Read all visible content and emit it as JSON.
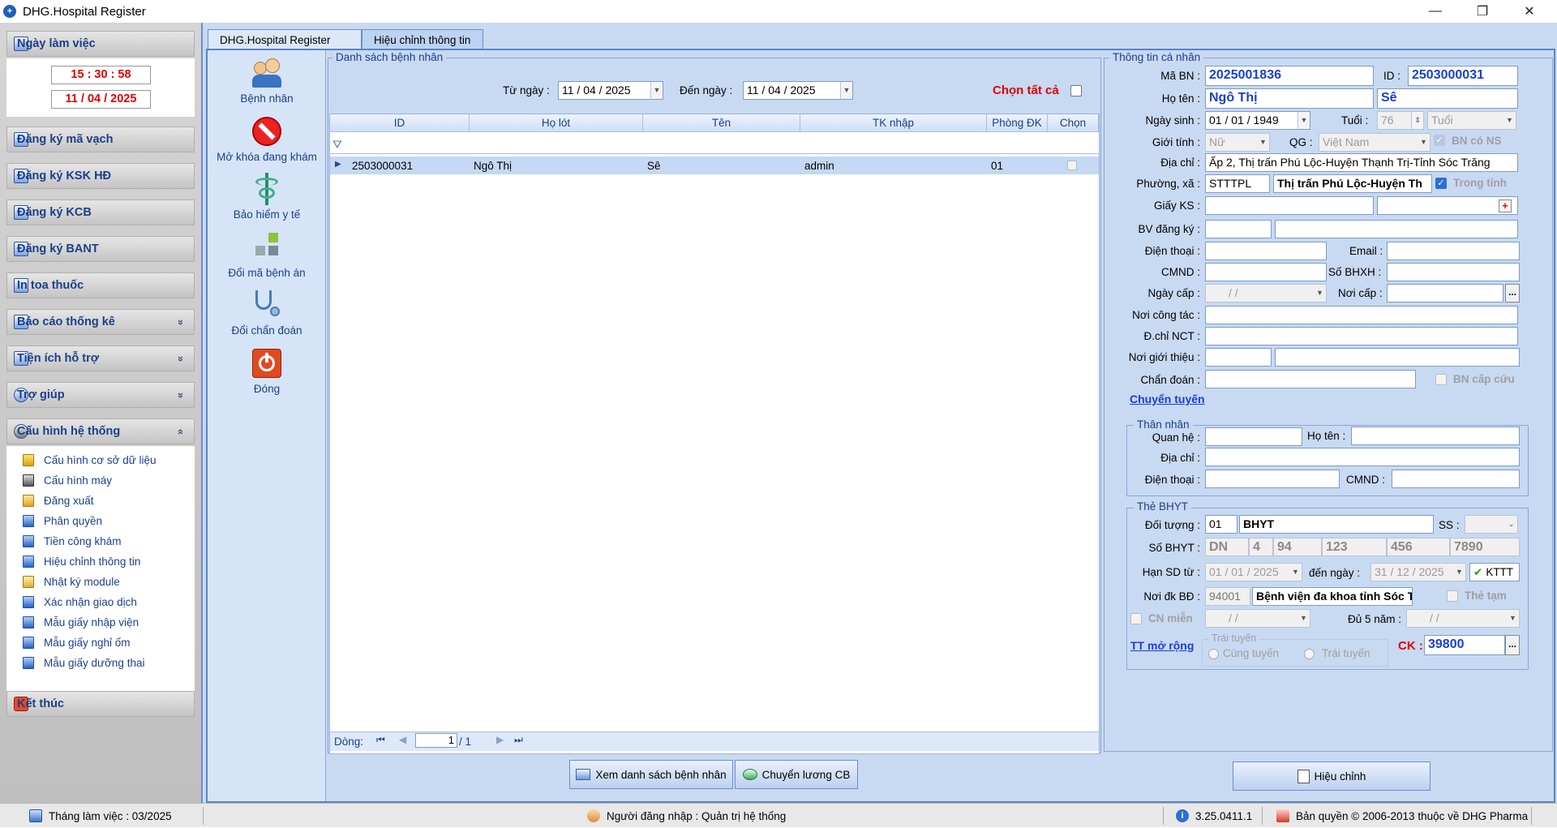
{
  "window": {
    "title": "DHG.Hospital Register",
    "icon": "hospital-cross-icon",
    "minimize": "—",
    "maximize": "❐",
    "close": "✕"
  },
  "sidebar": {
    "workday": {
      "label": "Ngày làm việc",
      "time": "15 : 30 : 58",
      "date": "11 / 04 / 2025"
    },
    "sections": [
      {
        "label": "Đăng ký mã vạch"
      },
      {
        "label": "Đăng ký KSK HĐ"
      },
      {
        "label": "Đăng ký KCB"
      },
      {
        "label": "Đăng ký BANT"
      },
      {
        "label": "In toa thuốc"
      },
      {
        "label": "Báo cáo thống kê",
        "chevron": "«"
      },
      {
        "label": "Tiện ích hỗ trợ",
        "chevron": "«"
      },
      {
        "label": "Trợ giúp",
        "chevron": "«"
      }
    ],
    "config": {
      "label": "Cấu hình hệ thống",
      "chevron": "»",
      "items": [
        "Cấu hình cơ sở dữ liệu",
        "Cấu hình máy",
        "Đăng xuất",
        "Phân quyền",
        "Tiền công khám",
        "Hiệu chỉnh thông tin",
        "Nhật ký module",
        "Xác nhận giao dịch",
        "Mẫu giấy nhập viện",
        "Mẫu giấy nghỉ ốm",
        "Mẫu giấy dưỡng thai"
      ]
    },
    "exit": "Kết thúc"
  },
  "tabs": [
    {
      "label": "DHG.Hospital Register",
      "active": false
    },
    {
      "label": "Hiệu chỉnh thông tin",
      "active": true
    }
  ],
  "tools": [
    "Bệnh nhân",
    "Mở khóa đang khám",
    "Bảo hiểm y tế",
    "Đổi mã bệnh án",
    "Đổi chẩn đoán",
    "Đóng"
  ],
  "list": {
    "title": "Danh sách bệnh nhân",
    "from_label": "Từ ngày :",
    "from_date": "11 / 04 / 2025",
    "to_label": "Đến  ngày :",
    "to_date": "11 / 04 / 2025",
    "select_all": "Chọn tất cả",
    "columns": [
      "ID",
      "Họ lót",
      "Tên",
      "TK nhập",
      "Phòng ĐK",
      "Chọn"
    ],
    "rows": [
      {
        "id": "2503000031",
        "ho_lot": "Ngô Thị",
        "ten": "Sê",
        "tk_nhap": "admin",
        "phong": "01"
      }
    ],
    "nav_label": "Dòng:",
    "page": "1",
    "total": "/   1"
  },
  "buttons": {
    "view_list": "Xem danh sách bệnh nhân",
    "transfer_salary": "Chuyển lương CB",
    "edit": "Hiệu chỉnh"
  },
  "patient": {
    "title": "Thông tin cá nhân",
    "ma_bn_label": "Mã BN :",
    "ma_bn": "2025001836",
    "id_label": "ID :",
    "id": "2503000031",
    "ho_ten_label": "Họ tên :",
    "ho": "Ngô Thị",
    "ten": "Sê",
    "ngay_sinh_label": "Ngày sinh :",
    "ngay_sinh": "01 / 01 / 1949",
    "tuoi_label": "Tuổi :",
    "tuoi": "76",
    "tuoi_unit": "Tuổi",
    "gioi_tinh_label": "Giới tính :",
    "gioi_tinh": "Nữ",
    "qg_label": "QG :",
    "qg": "Việt Nam",
    "bn_co_ns": "BN có NS",
    "dia_chi_label": "Địa chỉ :",
    "dia_chi": "Ấp 2, Thị trấn Phú Lộc-Huyện Thạnh Trị-Tỉnh Sóc Trăng",
    "phuong_label": "Phường, xã :",
    "phuong_code": "STTTPL",
    "phuong": "Thị trấn Phú Lộc-Huyện Th",
    "trong_tinh": "Trong tỉnh",
    "giay_ks_label": "Giấy KS :",
    "bv_dk_label": "BV đăng ký :",
    "dien_thoai_label": "Điện thoại :",
    "email_label": "Email :",
    "cmnd_label": "CMND :",
    "so_bhxh_label": "Số BHXH :",
    "ngay_cap_label": "Ngày cấp :",
    "ngay_cap": "/     /",
    "noi_cap_label": "Nơi cấp :",
    "noi_cong_tac_label": "Nơi công tác :",
    "dchi_nct_label": "Đ.chỉ NCT :",
    "noi_gioi_thieu_label": "Nơi giới thiệu :",
    "chan_doan_label": "Chẩn đoán :",
    "bn_cap_cuu": "BN cấp cứu",
    "chuyen_tuyen": "Chuyển tuyến",
    "ellipsis": "...",
    "add_icon": "+"
  },
  "relative": {
    "title": "Thân nhân",
    "quan_he_label": "Quan hệ :",
    "ho_ten_label": "Họ tên :",
    "dia_chi_label": "Địa chỉ :",
    "dien_thoai_label": "Điện thoại :",
    "cmnd_label": "CMND :"
  },
  "bhyt": {
    "title": "Thẻ BHYT",
    "doi_tuong_label": "Đối tượng :",
    "doi_tuong_code": "01",
    "doi_tuong": "BHYT",
    "ss_label": "SS :",
    "so_bhyt_label": "Số BHYT :",
    "so_parts": [
      "DN",
      "4",
      "94",
      "123",
      "456",
      "7890"
    ],
    "han_sd_label": "Hạn SD từ :",
    "han_tu": "01 / 01 / 2025",
    "den_label": "đến  ngày :",
    "han_den": "31 / 12 / 2025",
    "kttt": "KTTT",
    "noi_dk_label": "Nơi đk BĐ :",
    "noi_dk_code": "94001",
    "noi_dk": "Bệnh viện đa khoa tỉnh Sóc Trăng",
    "the_tam": "Thẻ tạm",
    "cn_mien": "CN miễn",
    "cn_date": "/     /",
    "du5nam_label": "Đủ 5 năm :",
    "du5nam_date": "/     /",
    "tt_mo_rong": "TT mở rộng",
    "trai_tuyen_group": "Trái tuyến",
    "cung_tuyen": "Cùng tuyến",
    "trai_tuyen": "Trái tuyến",
    "ck_label": "CK :",
    "ck": "39800"
  },
  "status": {
    "month": "Tháng làm việc : 03/2025",
    "user": "Người đăng nhập : Quản trị hệ thống",
    "version": "3.25.0411.1",
    "copyright": "Bản quyền © 2006-2013 thuộc về DHG Pharma"
  },
  "colors": {
    "accent": "#1a3fd4",
    "danger": "#e00000",
    "frame": "#c8d9f2",
    "border": "#5b84c4"
  }
}
